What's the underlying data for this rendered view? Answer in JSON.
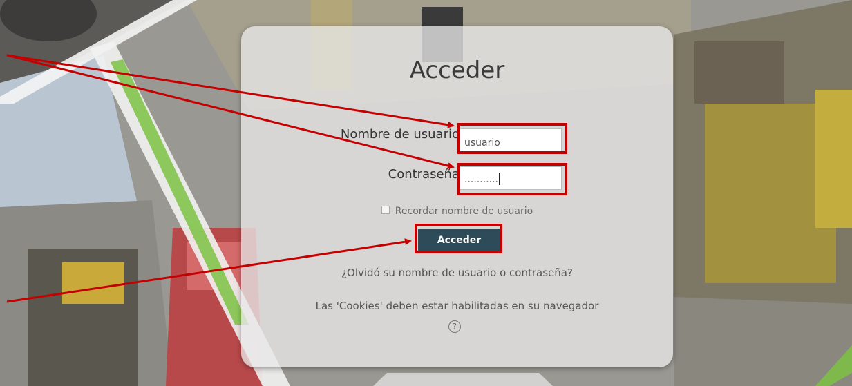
{
  "login": {
    "title": "Acceder",
    "username_label": "Nombre de usuario",
    "username_value": "usuario",
    "password_label": "Contraseña",
    "password_mask": "...........",
    "remember_label": "Recordar nombre de usuario",
    "remember_checked": false,
    "submit_label": "Acceder",
    "forgot_link": "¿Olvidó su nombre de usuario o contraseña?",
    "cookies_notice": "Las 'Cookies' deben estar habilitadas en su navegador",
    "help_icon": "?"
  },
  "annotation": {
    "color": "#c40000"
  },
  "colors": {
    "button_bg": "#2e4b5a",
    "accent_green": "#7cc243"
  }
}
